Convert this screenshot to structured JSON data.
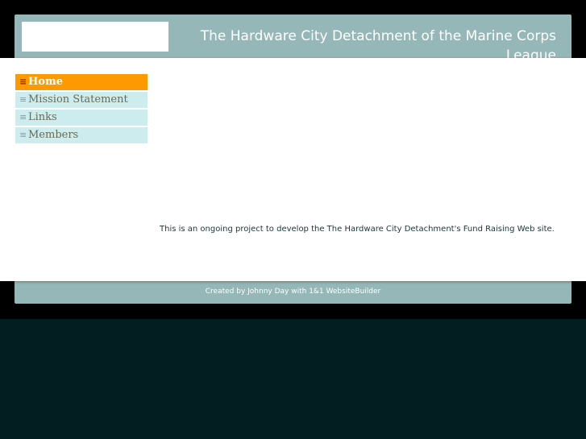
{
  "header": {
    "title": "The Hardware City Detachment of the Marine Corps League"
  },
  "nav": {
    "items": [
      {
        "label": "Home",
        "icon": "menu-icon",
        "active": true
      },
      {
        "label": "Mission Statement",
        "icon": "menu-icon",
        "active": false
      },
      {
        "label": "Links",
        "icon": "menu-icon",
        "active": false
      },
      {
        "label": "Members",
        "icon": "menu-icon",
        "active": false
      }
    ]
  },
  "main": {
    "text": "This is an ongoing project to develop the The Hardware City Detachment's Fund Raising Web site."
  },
  "footer": {
    "text": "Created by Johnny Day with 1&1 WebsiteBuilder"
  },
  "colors": {
    "frame": "#95b7b7",
    "nav_active": "#ff9900",
    "nav_inactive": "#cdeced",
    "bottom_band": "#021e21"
  }
}
